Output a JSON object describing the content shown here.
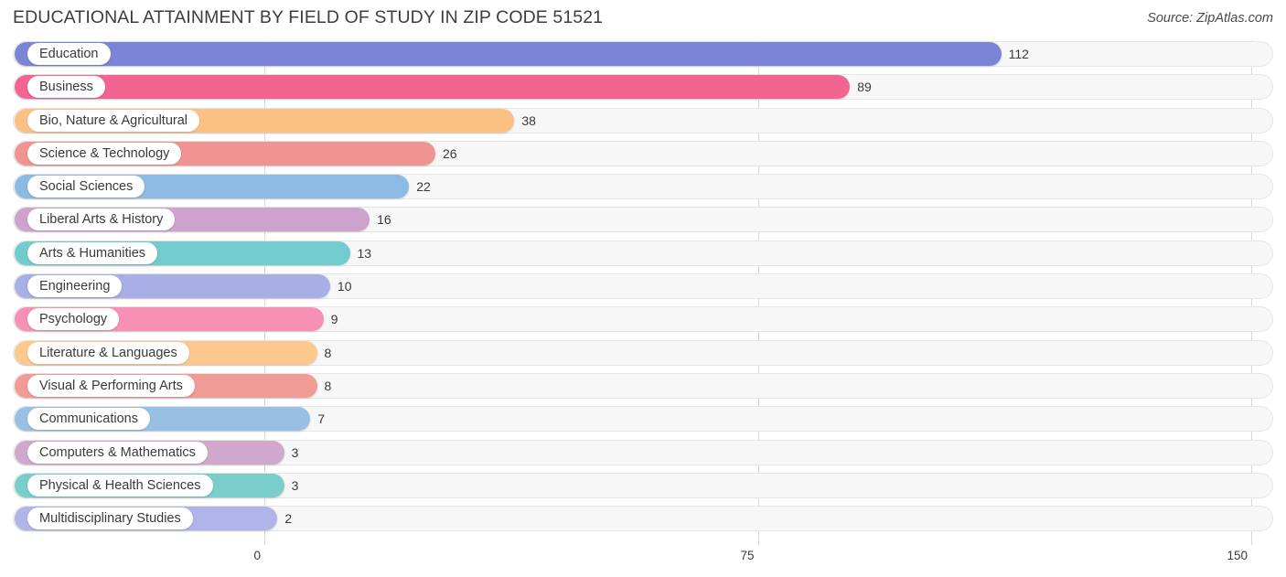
{
  "header": {
    "title": "EDUCATIONAL ATTAINMENT BY FIELD OF STUDY IN ZIP CODE 51521",
    "source": "Source: ZipAtlas.com"
  },
  "chart_data": {
    "type": "bar",
    "orientation": "horizontal",
    "title": "EDUCATIONAL ATTAINMENT BY FIELD OF STUDY IN ZIP CODE 51521",
    "xlabel": "",
    "ylabel": "",
    "xlim": [
      0,
      150
    ],
    "xticks": [
      0,
      75,
      150
    ],
    "xtick_labels": [
      "0",
      "75",
      "150"
    ],
    "grid": true,
    "legend": "none",
    "categories": [
      "Education",
      "Business",
      "Bio, Nature & Agricultural",
      "Science & Technology",
      "Social Sciences",
      "Liberal Arts & History",
      "Arts & Humanities",
      "Engineering",
      "Psychology",
      "Literature & Languages",
      "Visual & Performing Arts",
      "Communications",
      "Computers & Mathematics",
      "Physical & Health Sciences",
      "Multidisciplinary Studies"
    ],
    "values": [
      112,
      89,
      38,
      26,
      22,
      16,
      13,
      10,
      9,
      8,
      8,
      7,
      3,
      3,
      2
    ],
    "value_labels": [
      "112",
      "89",
      "38",
      "26",
      "22",
      "16",
      "13",
      "10",
      "9",
      "8",
      "8",
      "7",
      "3",
      "3",
      "2"
    ],
    "colors": [
      "#7b85d8",
      "#f26591",
      "#fbc183",
      "#ef9490",
      "#8bbbe3",
      "#cda3cd",
      "#72cbcd",
      "#a8aee6",
      "#f790b4",
      "#fbc98e",
      "#f09b96",
      "#97c0e4",
      "#cfa8cc",
      "#79cdcb",
      "#b0b4e8"
    ]
  }
}
